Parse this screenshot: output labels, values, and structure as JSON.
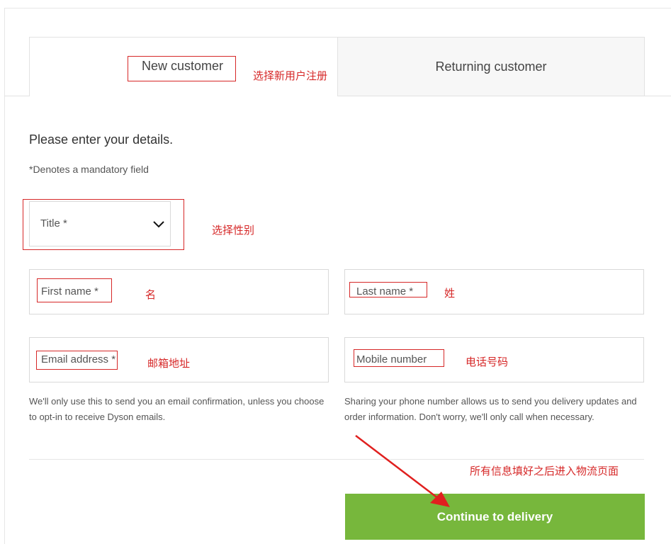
{
  "tabs": {
    "new_customer": "New customer",
    "returning_customer": "Returning customer"
  },
  "form": {
    "heading": "Please enter your details.",
    "mandatory_note": "*Denotes a mandatory field",
    "title_label": "Title *",
    "first_name_label": "First name *",
    "last_name_label": "Last name *",
    "email_label": "Email address *",
    "mobile_label": "Mobile number",
    "email_help": "We'll only use this to send you an email confirmation, unless you choose to opt-in to receive Dyson emails.",
    "mobile_help": "Sharing your phone number allows us to send you delivery updates and order information. Don't worry, we'll only call when necessary.",
    "continue_label": "Continue to delivery"
  },
  "annotations": {
    "new_customer": "选择新用户注册",
    "title": "选择性别",
    "first_name": "名",
    "last_name": "姓",
    "email": "邮箱地址",
    "mobile": "电话号码",
    "continue": "所有信息填好之后进入物流页面"
  },
  "colors": {
    "accent_green": "#77b73c",
    "annotation_red": "#d62828"
  },
  "icons": {
    "title_select": "chevron-down-icon"
  }
}
